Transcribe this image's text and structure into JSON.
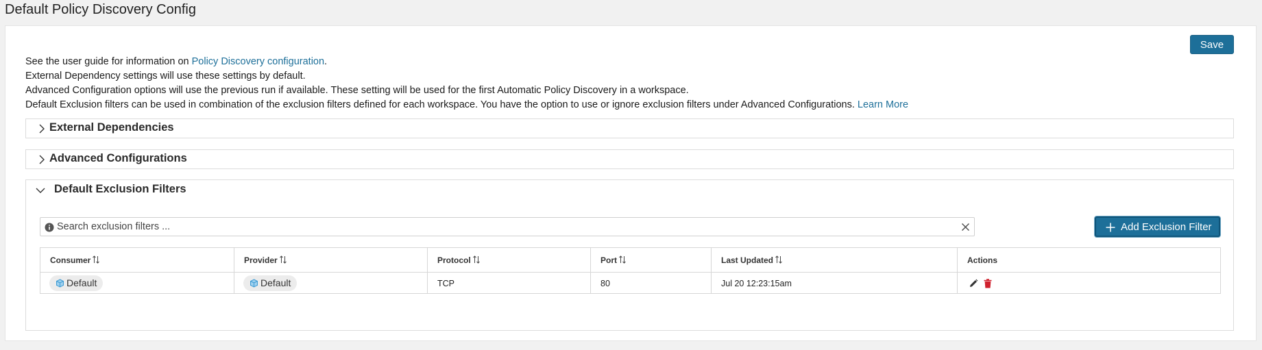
{
  "page": {
    "title": "Default Policy Discovery Config"
  },
  "toolbar": {
    "save_label": "Save"
  },
  "info": {
    "line1_prefix": "See the user guide for information on ",
    "line1_link": "Policy Discovery configuration",
    "line1_suffix": ".",
    "line2": "External Dependency settings will use these settings by default.",
    "line3": "Advanced Configuration options will use the previous run if available. These setting will be used for the first Automatic Policy Discovery in a workspace.",
    "line4_prefix": "Default Exclusion filters can be used in combination of the exclusion filters defined for each workspace. You have the option to use or ignore exclusion filters under Advanced Configurations. ",
    "line4_link": "Learn More"
  },
  "sections": {
    "external": {
      "title": "External Dependencies",
      "expanded": false
    },
    "advanced": {
      "title": "Advanced Configurations",
      "expanded": false
    },
    "exclusion": {
      "title": "Default Exclusion Filters",
      "expanded": true
    }
  },
  "search": {
    "placeholder": "Search exclusion filters ...",
    "value": ""
  },
  "add_button": {
    "label": "Add Exclusion Filter"
  },
  "table": {
    "columns": [
      "Consumer",
      "Provider",
      "Protocol",
      "Port",
      "Last Updated",
      "Actions"
    ],
    "rows": [
      {
        "consumer": "Default",
        "provider": "Default",
        "protocol": "TCP",
        "port": "80",
        "last_updated": "Jul 20 12:23:15am"
      }
    ]
  },
  "icons": {
    "info": "info-circle-icon",
    "clear": "close-icon",
    "plus": "plus-icon",
    "sort": "sort-arrows-icon",
    "scope": "cube-icon",
    "edit": "pencil-icon",
    "delete": "trash-icon",
    "collapsed": "chevron-right-icon",
    "expanded": "chevron-down-icon"
  },
  "colors": {
    "primary": "#1d6f99",
    "link": "#1d6f99",
    "delete": "#d0212e",
    "scope_icon": "#3a9ad4"
  }
}
